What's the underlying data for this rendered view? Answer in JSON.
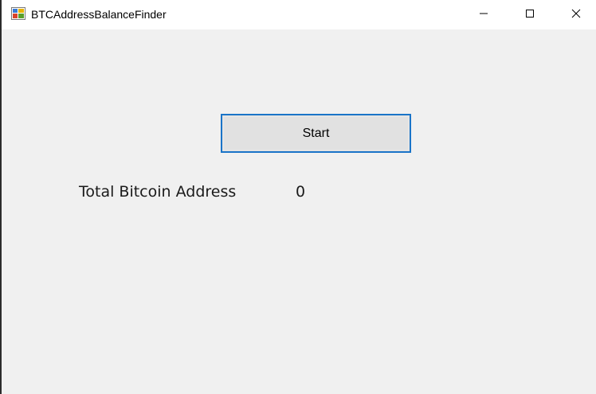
{
  "window": {
    "title": "BTCAddressBalanceFinder",
    "app_icon": "winforms-app-icon",
    "controls": {
      "minimize_icon": "minimize-icon",
      "maximize_icon": "maximize-icon",
      "close_icon": "close-icon"
    }
  },
  "form": {
    "start_button_label": "Start",
    "total_label": "Total Bitcoin Address",
    "total_value": "0"
  },
  "colors": {
    "form_background": "#f0f0f0",
    "titlebar_background": "#ffffff",
    "button_face": "#e1e1e1",
    "button_focus_border": "#1a74c8"
  }
}
